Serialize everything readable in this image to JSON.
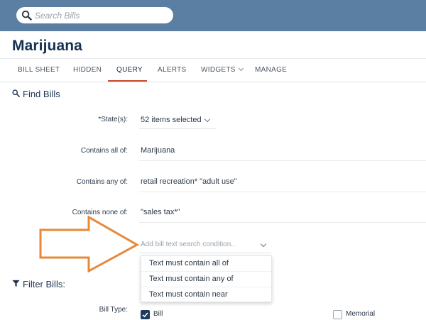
{
  "search": {
    "placeholder": "Search Bills"
  },
  "page": {
    "title": "Marijuana"
  },
  "tabs": [
    {
      "label": "BILL SHEET"
    },
    {
      "label": "HIDDEN"
    },
    {
      "label": "QUERY"
    },
    {
      "label": "ALERTS"
    },
    {
      "label": "WIDGETS"
    },
    {
      "label": "MANAGE"
    }
  ],
  "find_bills": {
    "title": "Find Bills",
    "fields": [
      {
        "label": "*State(s):",
        "value": "52 items selected"
      },
      {
        "label": "Contains all of:",
        "value": "Marijuana"
      },
      {
        "label": "Contains any of:",
        "value": "retail recreation* \"adult use\""
      },
      {
        "label": "Contains none of:",
        "value": "\"sales tax*\""
      }
    ],
    "condition_placeholder": "Add bill text search condition..",
    "condition_options": [
      "Text must contain all of",
      "Text must contain any of",
      "Text must contain near"
    ]
  },
  "filter_bills": {
    "title": "Filter Bills:",
    "bill_type_label": "Bill Type:",
    "options": [
      {
        "label": "Bill",
        "checked": true
      },
      {
        "label": "Memorial",
        "checked": false
      }
    ]
  },
  "colors": {
    "header": "#5b7fa3",
    "accent": "#c9492e",
    "title": "#163252",
    "arrow": "#e8893a",
    "checkbox": "#1d3a5e"
  },
  "icons": [
    "search-icon",
    "magnifier-icon",
    "funnel-icon",
    "chevron-down-icon",
    "check-icon"
  ]
}
